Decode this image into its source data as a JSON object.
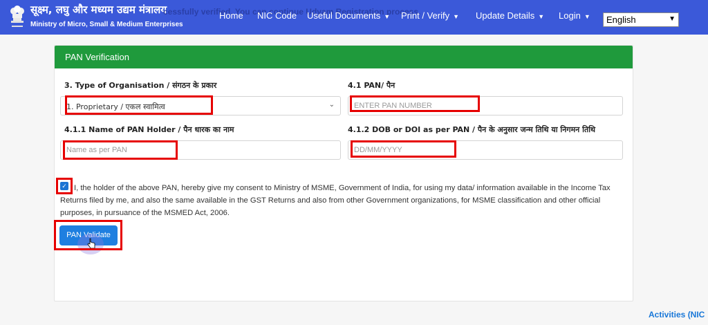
{
  "header": {
    "brand_hindi": "सूक्ष्म, लघु और मध्यम उद्यम मंत्रालय",
    "brand_english": "Ministry of Micro, Small & Medium Enterprises",
    "ticker_text": "cessfully verified. You can continue Udyam Registration process.",
    "emblem_icon": "national-emblem-icon",
    "nav": {
      "home": "Home",
      "nic_code": "NIC Code",
      "useful_documents": "Useful Documents",
      "print_verify": "Print / Verify",
      "update_details": "Update Details",
      "login": "Login"
    },
    "language": {
      "selected": "English"
    },
    "bar_color": "#3b59d9"
  },
  "card": {
    "title": "PAN Verification",
    "header_color": "#1f9a3c",
    "org_type": {
      "label": "3. Type of Organisation / संगठन के प्रकार",
      "selected": "1. Proprietary / एकल स्वामित्व"
    },
    "pan": {
      "label": "4.1 PAN/ पैन",
      "placeholder": "ENTER PAN NUMBER"
    },
    "pan_holder": {
      "label": "4.1.1 Name of PAN Holder / पैन धारक का नाम",
      "placeholder": "Name as per PAN"
    },
    "dob": {
      "label": "4.1.2 DOB or DOI as per PAN / पैन के अनुसार जन्म तिथि या निगमन तिथि",
      "placeholder": "DD/MM/YYYY"
    },
    "consent": {
      "checked": true,
      "line1": "I, the holder of the above PAN, hereby give my consent to Ministry of MSME, Government of India, for using my data/ information available in the Income Tax",
      "line2": "Returns filed by me, and also the same available in the GST Returns and also from other Government organizations, for MSME classification and other official",
      "line3": "purposes, in pursuance of the MSMED Act, 2006."
    },
    "validate_button": "PAN Validate"
  },
  "footer": {
    "activities_link": "Activities (NIC"
  },
  "highlight_color": "#e60000"
}
